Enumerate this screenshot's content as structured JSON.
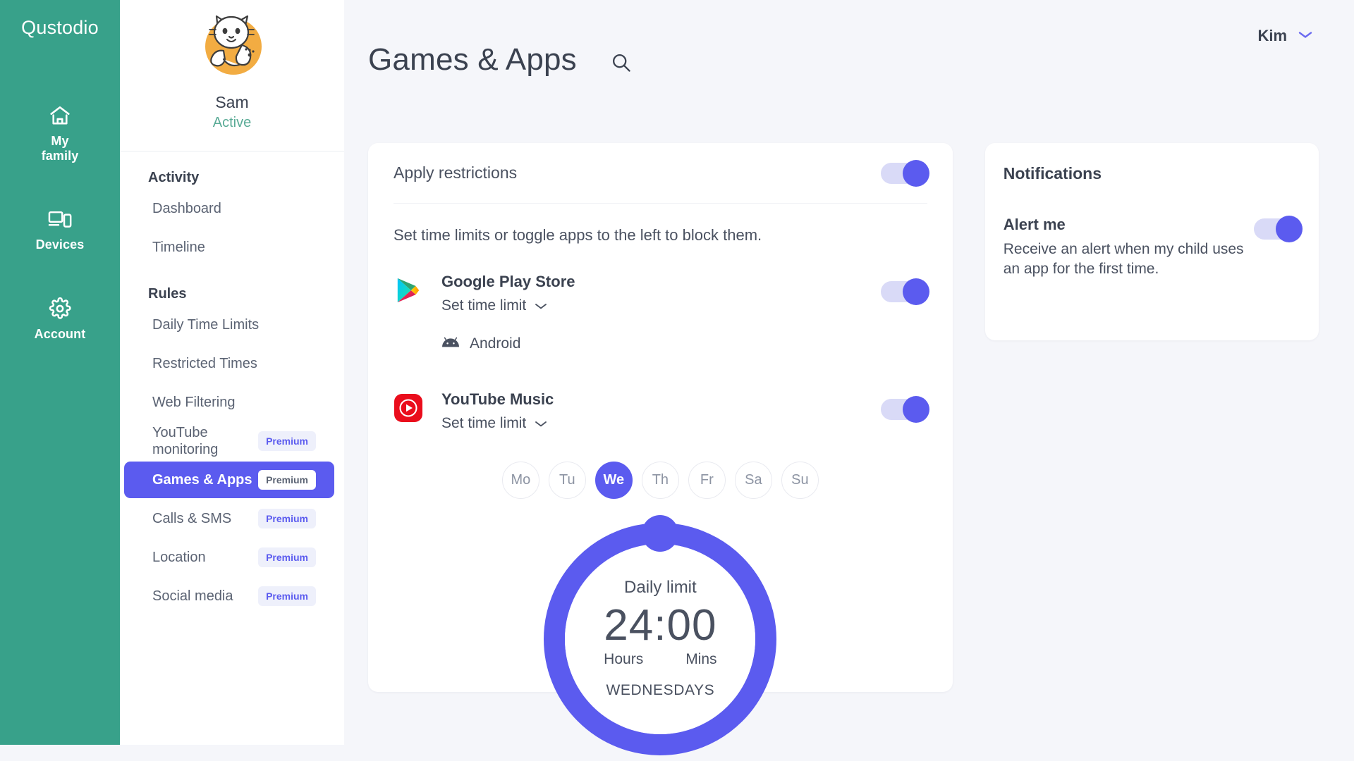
{
  "brand": {
    "name": "Qustodio",
    "green": "#38a18a",
    "accent": "#5b5bef"
  },
  "rail": {
    "items": [
      {
        "label": "My\nfamily",
        "line1": "My",
        "line2": "family",
        "icon": "home-icon"
      },
      {
        "label": "Devices",
        "line1": "Devices",
        "line2": "",
        "icon": "devices-icon"
      },
      {
        "label": "Account",
        "line1": "Account",
        "line2": "",
        "icon": "gear-icon"
      }
    ]
  },
  "sidebar": {
    "profile": {
      "name": "Sam",
      "status": "Active",
      "avatar": "cat-avatar"
    },
    "sections": [
      {
        "title": "Activity",
        "items": [
          {
            "label": "Dashboard",
            "badge": "",
            "active": false
          },
          {
            "label": "Timeline",
            "badge": "",
            "active": false
          }
        ]
      },
      {
        "title": "Rules",
        "items": [
          {
            "label": "Daily Time Limits",
            "badge": "",
            "active": false
          },
          {
            "label": "Restricted Times",
            "badge": "",
            "active": false
          },
          {
            "label": "Web Filtering",
            "badge": "",
            "active": false
          },
          {
            "label": "YouTube monitoring",
            "badge": "Premium",
            "active": false
          },
          {
            "label": "Games & Apps",
            "badge": "Premium",
            "active": true
          },
          {
            "label": "Calls & SMS",
            "badge": "Premium",
            "active": false
          },
          {
            "label": "Location",
            "badge": "Premium",
            "active": false
          },
          {
            "label": "Social media",
            "badge": "Premium",
            "active": false
          }
        ]
      }
    ]
  },
  "header": {
    "title": "Games & Apps",
    "search_icon": "search-icon",
    "user": "Kim",
    "chevron_icon": "chevron-down-icon"
  },
  "main": {
    "apply_restrictions_label": "Apply restrictions",
    "apply_restrictions_on": true,
    "helper_text": "Set time limits or toggle apps to the left to block them.",
    "apps": [
      {
        "name": "Google Play Store",
        "time_limit_label": "Set time limit",
        "icon": "google-play-icon",
        "enabled": true,
        "platform": "Android",
        "platform_icon": "android-icon"
      },
      {
        "name": "YouTube Music",
        "time_limit_label": "Set time limit",
        "icon": "youtube-music-icon",
        "enabled": true,
        "platform": "",
        "platform_icon": ""
      }
    ],
    "day_picker": {
      "days": [
        "Mo",
        "Tu",
        "We",
        "Th",
        "Fr",
        "Sa",
        "Su"
      ],
      "selected": "We"
    },
    "dial": {
      "caption": "Daily limit",
      "value": "24:00",
      "unit_left": "Hours",
      "unit_right": "Mins",
      "day_label": "WEDNESDAYS"
    }
  },
  "notifications": {
    "title": "Notifications",
    "alert_title": "Alert me",
    "alert_desc": "Receive an alert when my child uses an app for the first time.",
    "alert_on": true
  }
}
